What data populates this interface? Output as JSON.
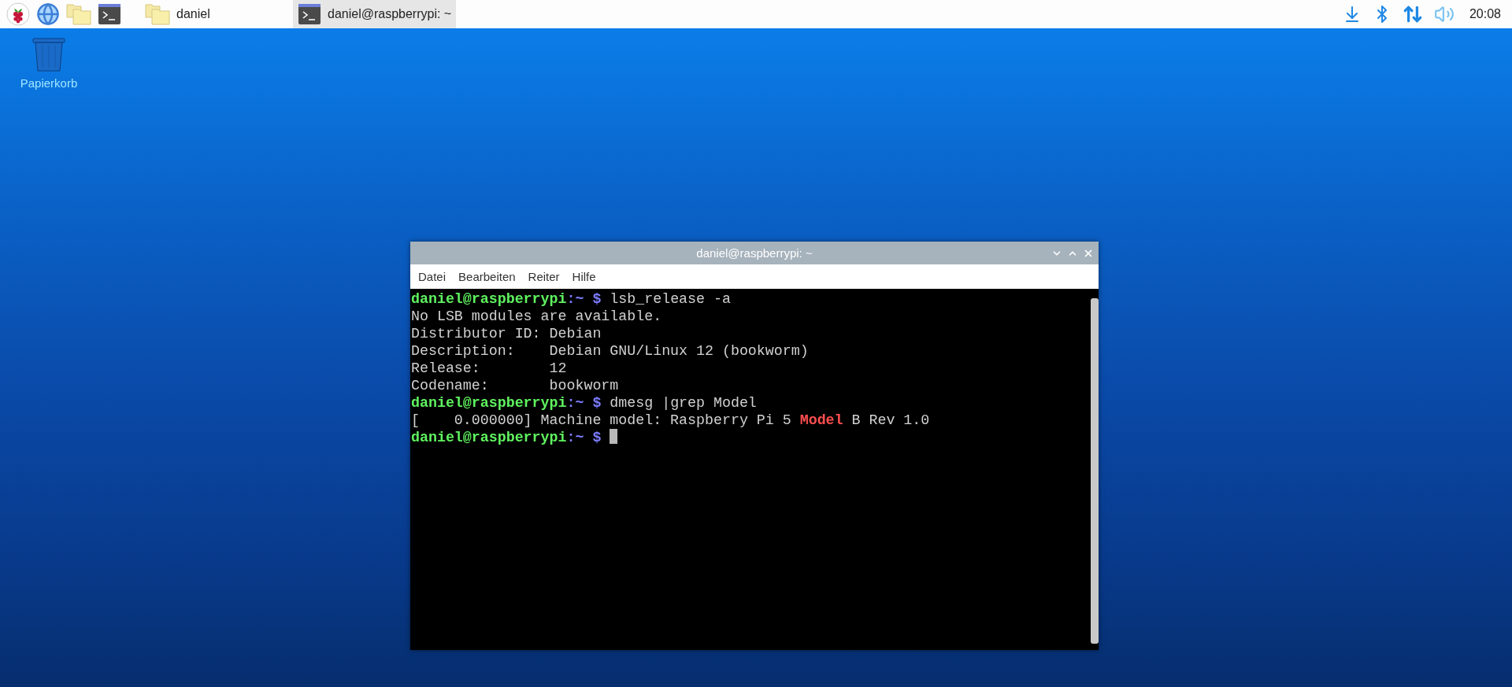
{
  "taskbar": {
    "launchers": [
      {
        "kind": "menu"
      },
      {
        "kind": "browser"
      },
      {
        "kind": "files"
      },
      {
        "kind": "terminal"
      }
    ],
    "tasks": [
      {
        "kind": "files",
        "label": "daniel",
        "selected": false
      },
      {
        "kind": "terminal",
        "label": "daniel@raspberrypi: ~",
        "selected": true
      }
    ],
    "tray": [
      {
        "kind": "update"
      },
      {
        "kind": "bluetooth"
      },
      {
        "kind": "network"
      },
      {
        "kind": "volume"
      }
    ],
    "clock": "20:08"
  },
  "desktop_icons": [
    {
      "kind": "trash",
      "label": "Papierkorb"
    }
  ],
  "terminal_window": {
    "title": "daniel@raspberrypi: ~",
    "menu": [
      "Datei",
      "Bearbeiten",
      "Reiter",
      "Hilfe"
    ],
    "lines": [
      [
        {
          "kind": "user",
          "text": "daniel@raspberrypi"
        },
        {
          "kind": "path",
          "text": ":~ $"
        },
        {
          "kind": "plain",
          "text": " lsb_release -a"
        }
      ],
      [
        {
          "kind": "plain",
          "text": "No LSB modules are available."
        }
      ],
      [
        {
          "kind": "plain",
          "text": "Distributor ID: Debian"
        }
      ],
      [
        {
          "kind": "plain",
          "text": "Description:    Debian GNU/Linux 12 (bookworm)"
        }
      ],
      [
        {
          "kind": "plain",
          "text": "Release:        12"
        }
      ],
      [
        {
          "kind": "plain",
          "text": "Codename:       bookworm"
        }
      ],
      [
        {
          "kind": "user",
          "text": "daniel@raspberrypi"
        },
        {
          "kind": "path",
          "text": ":~ $"
        },
        {
          "kind": "plain",
          "text": " dmesg |grep Model"
        }
      ],
      [
        {
          "kind": "plain",
          "text": "[    0.000000] Machine model: Raspberry Pi 5 "
        },
        {
          "kind": "match",
          "text": "Model"
        },
        {
          "kind": "plain",
          "text": " B Rev 1.0"
        }
      ],
      [
        {
          "kind": "user",
          "text": "daniel@raspberrypi"
        },
        {
          "kind": "path",
          "text": ":~ $"
        },
        {
          "kind": "cursor"
        }
      ]
    ]
  }
}
